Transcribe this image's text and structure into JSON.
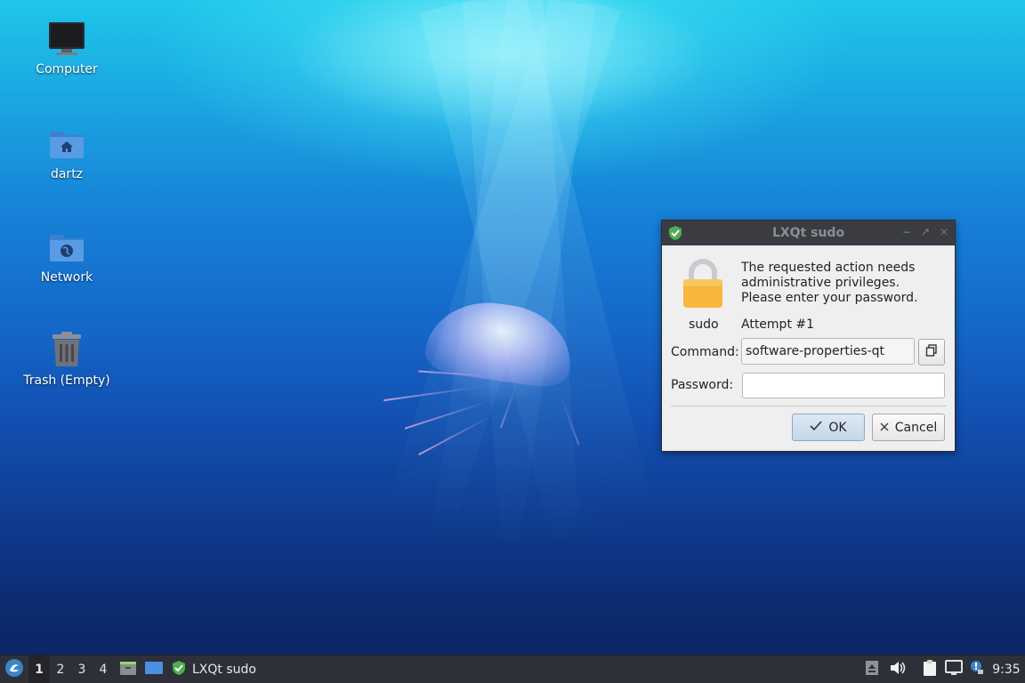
{
  "desktop": {
    "icons": [
      {
        "label": "Computer",
        "icon": "monitor-icon"
      },
      {
        "label": "dartz",
        "icon": "home-folder-icon"
      },
      {
        "label": "Network",
        "icon": "network-folder-icon"
      },
      {
        "label": "Trash (Empty)",
        "icon": "trash-icon"
      }
    ]
  },
  "dialog": {
    "title": "LXQt sudo",
    "title_icon": "shield-check-icon",
    "lock_icon": "padlock-icon",
    "lock_caption": "sudo",
    "message": "The requested action needs administrative privileges. Please enter your password.",
    "message_lines": [
      "The requested action needs",
      "administrative privileges.",
      "Please enter your password."
    ],
    "attempt": "Attempt #1",
    "command_label": "Command:",
    "command_value": "software-properties-qt",
    "copy_icon": "copy-icon",
    "password_label": "Password:",
    "password_value": "",
    "ok_label": "OK",
    "cancel_label": "Cancel",
    "controls": {
      "minimize": "−",
      "maximize": "↗",
      "close": "✕"
    }
  },
  "taskbar": {
    "start_icon": "lxqt-menu-icon",
    "workspaces": [
      "1",
      "2",
      "3",
      "4"
    ],
    "active_workspace": "1",
    "quicklaunch": [
      "file-manager-icon",
      "show-desktop-icon"
    ],
    "task_label": "LXQt sudo",
    "task_icon": "shield-check-icon",
    "tray": [
      "eject-icon",
      "volume-icon",
      "clipboard-icon",
      "network-icon",
      "notification-icon"
    ],
    "clock": "9:35"
  },
  "colors": {
    "accent": "#3daee9",
    "titlebar": "#3a3c42",
    "taskbar": "#2d3038",
    "shield_green": "#4caf50",
    "folder_blue": "#5294e2"
  }
}
